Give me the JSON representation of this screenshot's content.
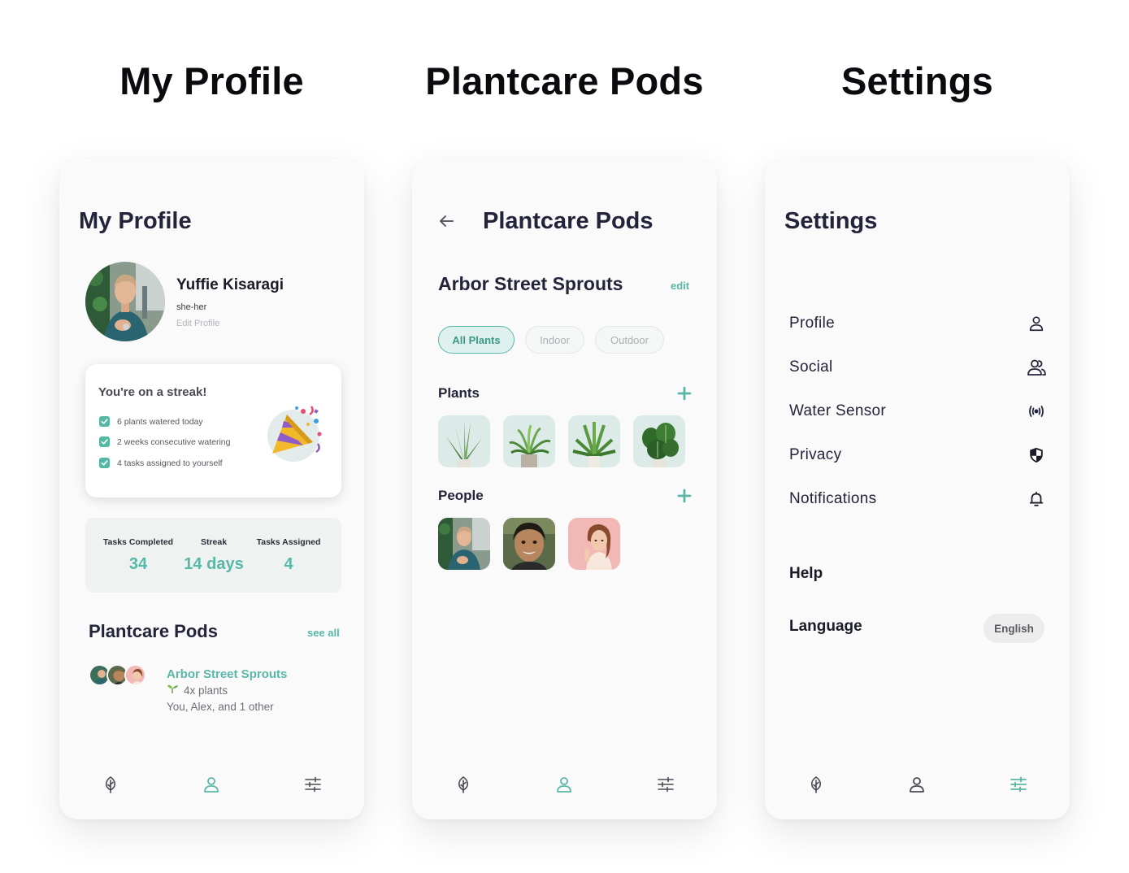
{
  "headlines": {
    "profile": "My Profile",
    "pods": "Plantcare Pods",
    "settings": "Settings"
  },
  "profile_screen": {
    "title": "My Profile",
    "name": "Yuffie Kisaragi",
    "pronouns": "she-her",
    "edit_profile": "Edit Profile",
    "streak": {
      "title": "You're on a streak!",
      "items": [
        "6 plants watered today",
        "2 weeks consecutive watering",
        "4 tasks assigned to yourself"
      ]
    },
    "stats": [
      {
        "label": "Tasks Completed",
        "value": "34"
      },
      {
        "label": "Streak",
        "value": "14 days"
      },
      {
        "label": "Tasks Assigned",
        "value": "4"
      }
    ],
    "pods_section": {
      "title": "Plantcare Pods",
      "see_all": "see all",
      "pod_name": "Arbor Street Sprouts",
      "plants": "4x plants",
      "members": "You, Alex, and 1 other"
    }
  },
  "pods_screen": {
    "title": "Plantcare Pods",
    "pod_name": "Arbor Street Sprouts",
    "edit": "edit",
    "filters": [
      "All Plants",
      "Indoor",
      "Outdoor"
    ],
    "active_filter": "All Plants",
    "plants_title": "Plants",
    "people_title": "People"
  },
  "settings_screen": {
    "title": "Settings",
    "items": [
      {
        "label": "Profile",
        "icon": "user-icon"
      },
      {
        "label": "Social",
        "icon": "users-icon"
      },
      {
        "label": "Water Sensor",
        "icon": "broadcast-icon"
      },
      {
        "label": "Privacy",
        "icon": "shield-icon"
      },
      {
        "label": "Notifications",
        "icon": "bell-icon"
      }
    ],
    "help": "Help",
    "language_label": "Language",
    "language_value": "English"
  },
  "nav_icons": [
    "leaf-icon",
    "user-icon",
    "sliders-icon"
  ],
  "active_nav": {
    "profile_screen": "user-icon",
    "pods_screen": "user-icon",
    "settings_screen": "sliders-icon"
  },
  "colors": {
    "accent": "#58b7a6",
    "title_text": "#23243a",
    "inactive_icon": "#4a4a55",
    "phone_bg": "#fafafa"
  }
}
